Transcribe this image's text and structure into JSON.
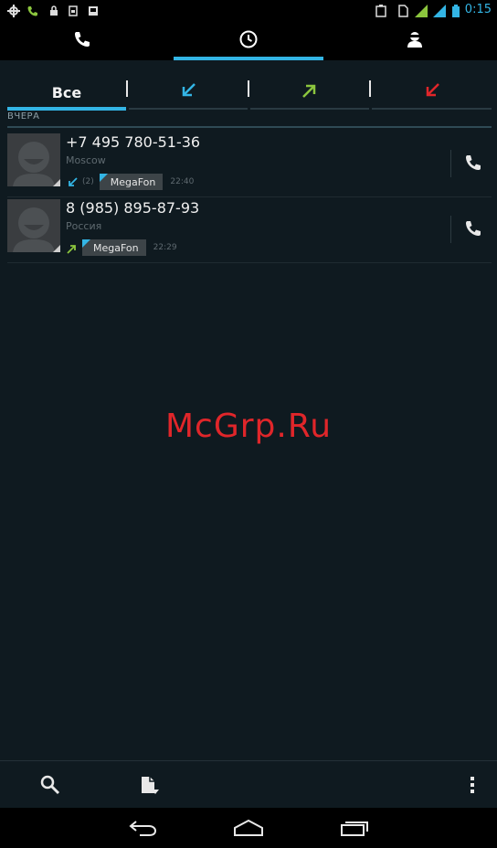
{
  "status_bar": {
    "time": "0:15",
    "left_icons": [
      "crosshair-icon",
      "call-icon",
      "lock-icon",
      "sim-icon",
      "image-icon"
    ],
    "right_icons": [
      "battery-icon",
      "signal-icon",
      "signal-icon",
      "battery-icon"
    ],
    "accent_color": "#33b5e5"
  },
  "top_tabs": [
    {
      "name": "phone",
      "icon": "phone-icon",
      "selected": false
    },
    {
      "name": "recent",
      "icon": "clock-icon",
      "selected": true
    },
    {
      "name": "contacts",
      "icon": "contact-icon",
      "selected": false
    }
  ],
  "filter_tabs": [
    {
      "label": "Все",
      "selected": true
    },
    {
      "icon": "incoming-arrow-icon",
      "color": "#33b5e5",
      "selected": false
    },
    {
      "icon": "outgoing-arrow-icon",
      "color": "#8cc63e",
      "selected": false
    },
    {
      "icon": "missed-arrow-icon",
      "color": "#e0262a",
      "selected": false
    }
  ],
  "section_header": "ВЧЕРА",
  "calls": [
    {
      "number": "+7 495 780-51-36",
      "location": "Moscow",
      "direction": "incoming",
      "direction_color": "#33b5e5",
      "count": "(2)",
      "sim": "MegaFon",
      "time": "22:40"
    },
    {
      "number": "8 (985) 895-87-93",
      "location": "Россия",
      "direction": "outgoing",
      "direction_color": "#8cc63e",
      "count": "",
      "sim": "MegaFon",
      "time": "22:29"
    }
  ],
  "watermark": "McGrp.Ru",
  "bottom_bar": {
    "icons": [
      "search-icon",
      "document-icon",
      "overflow-menu-icon"
    ]
  },
  "nav_bar": {
    "icons": [
      "back-icon",
      "home-icon",
      "recents-icon"
    ]
  }
}
